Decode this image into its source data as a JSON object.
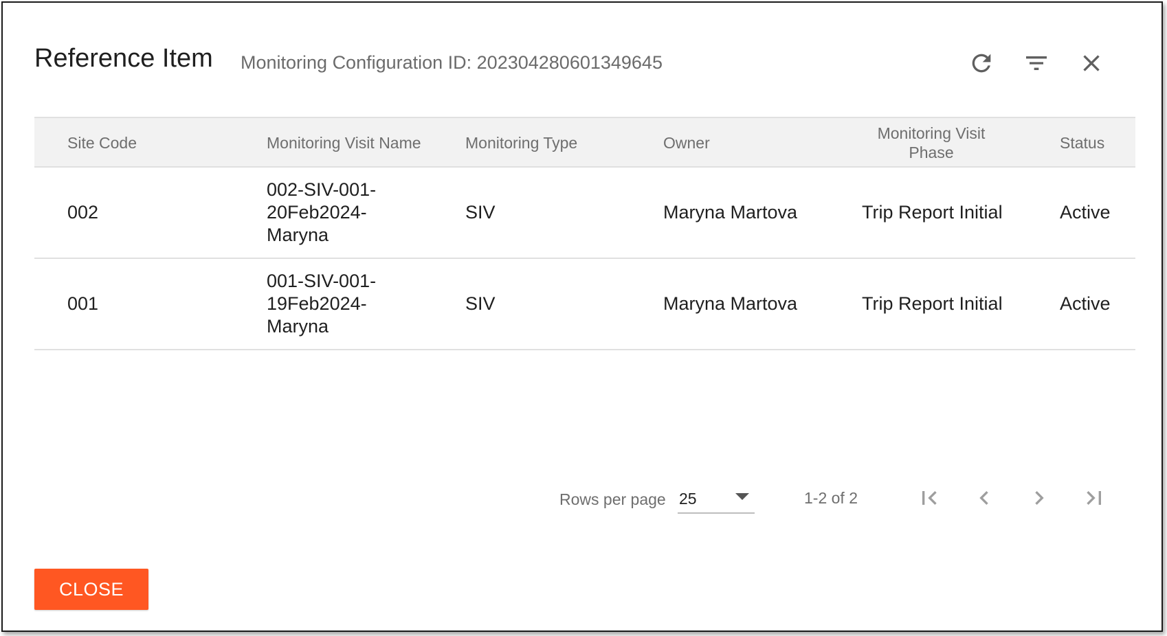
{
  "dialog": {
    "title": "Reference Item",
    "subtitle": "Monitoring Configuration ID: 202304280601349645",
    "toolbar": {
      "refresh_icon": "refresh-icon",
      "filter_icon": "filter-icon",
      "close_icon": "close-icon"
    }
  },
  "table": {
    "columns": [
      "Site Code",
      "Monitoring Visit Name",
      "Monitoring Type",
      "Owner",
      "Monitoring Visit Phase",
      "Status"
    ],
    "rows": [
      {
        "site_code": "002",
        "visit_name": "002-SIV-001-20Feb2024-Maryna",
        "visit_name_lines": [
          "002-SIV-001-",
          "20Feb2024-",
          "Maryna"
        ],
        "type": "SIV",
        "owner": "Maryna Martova",
        "phase": "Trip Report Initial",
        "status": "Active"
      },
      {
        "site_code": "001",
        "visit_name": "001-SIV-001-19Feb2024-Maryna",
        "visit_name_lines": [
          "001-SIV-001-",
          "19Feb2024-",
          "Maryna"
        ],
        "type": "SIV",
        "owner": "Maryna Martova",
        "phase": "Trip Report Initial",
        "status": "Active"
      }
    ]
  },
  "pagination": {
    "rows_per_page_label": "Rows per page",
    "rows_per_page_value": "25",
    "range_text": "1-2 of 2",
    "first_icon": "first-page-icon",
    "prev_icon": "chevron-left-icon",
    "next_icon": "chevron-right-icon",
    "last_icon": "last-page-icon"
  },
  "footer": {
    "close_label": "CLOSE"
  },
  "colors": {
    "accent": "#ff5722",
    "header_bg": "#f2f2f2",
    "muted_text": "#6e6e6e"
  }
}
